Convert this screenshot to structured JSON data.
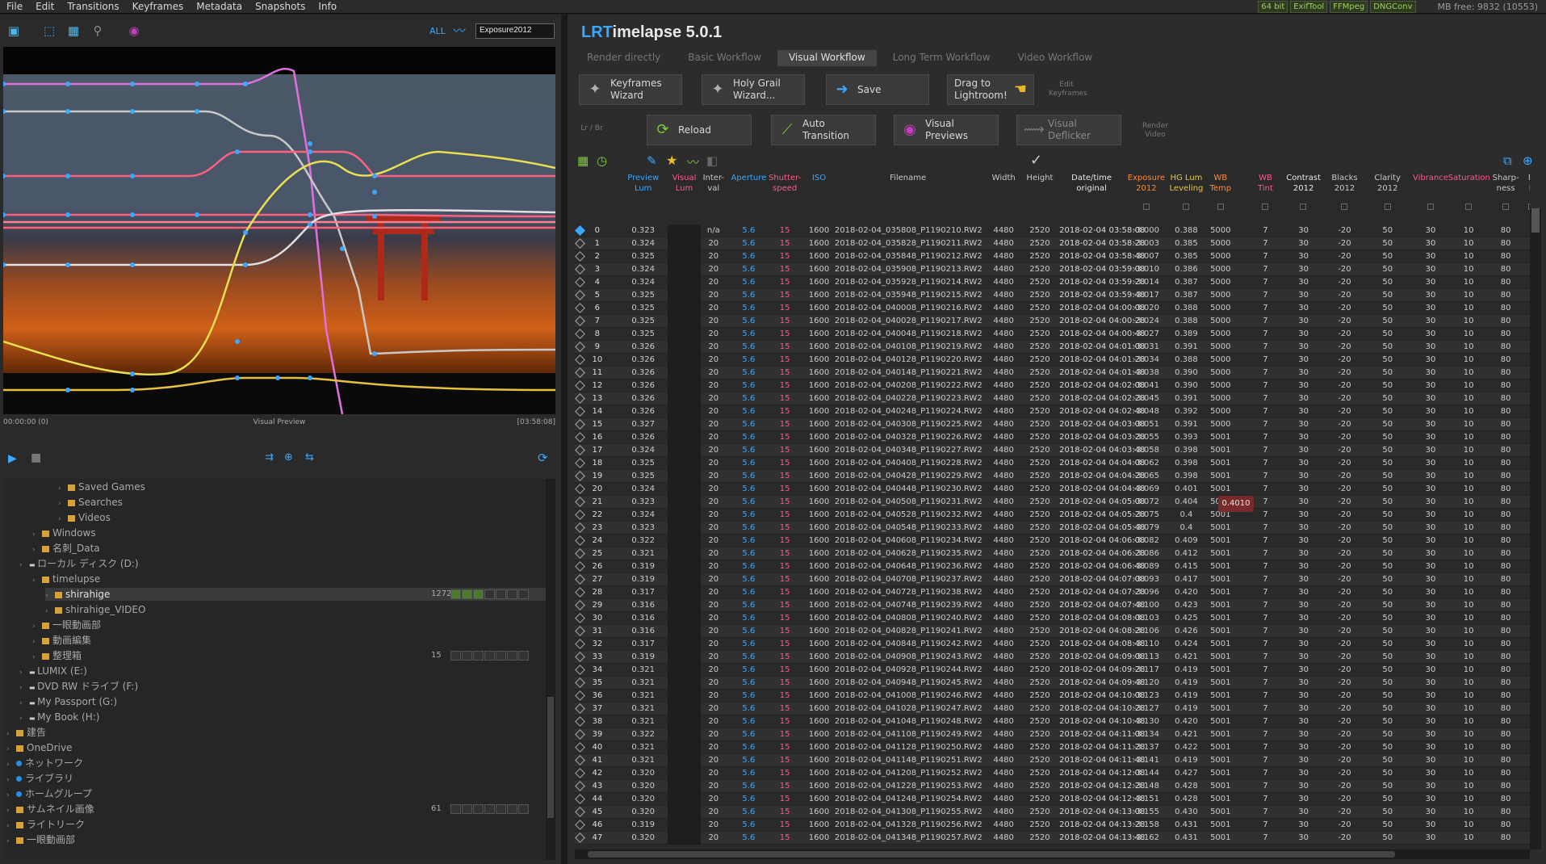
{
  "menu": [
    "File",
    "Edit",
    "Transitions",
    "Keyframes",
    "Metadata",
    "Snapshots",
    "Info"
  ],
  "badges": [
    "64 bit",
    "ExifTool",
    "FFMpeg",
    "DNGConv"
  ],
  "mbfree": "MB free: 9832 (10553)",
  "left_toolbar": {
    "all_label": "ALL",
    "curve_select": "Exposure2012"
  },
  "preview": {
    "time_start": "00:00:00 (0)",
    "label": "Visual Preview",
    "time_end": "[03:58:08]"
  },
  "tree": [
    {
      "label": "Saved Games",
      "indent": 4,
      "type": "folder"
    },
    {
      "label": "Searches",
      "indent": 4,
      "type": "folder"
    },
    {
      "label": "Videos",
      "indent": 4,
      "type": "folder"
    },
    {
      "label": "Windows",
      "indent": 2,
      "type": "folder"
    },
    {
      "label": "名刺_Data",
      "indent": 2,
      "type": "folder"
    },
    {
      "label": "ローカル ディスク (D:)",
      "indent": 1,
      "type": "drive"
    },
    {
      "label": "timelupse",
      "indent": 2,
      "type": "folder"
    },
    {
      "label": "shirahige",
      "indent": 3,
      "type": "folder",
      "selected": true,
      "count": "1272"
    },
    {
      "label": "shirahige_VIDEO",
      "indent": 3,
      "type": "folder"
    },
    {
      "label": "一眼動画部",
      "indent": 2,
      "type": "folder"
    },
    {
      "label": "動画編集",
      "indent": 2,
      "type": "folder"
    },
    {
      "label": "整理箱",
      "indent": 2,
      "type": "folder",
      "count": "15"
    },
    {
      "label": "LUMIX (E:)",
      "indent": 1,
      "type": "drive"
    },
    {
      "label": "DVD RW ドライブ (F:)",
      "indent": 1,
      "type": "drive"
    },
    {
      "label": "My Passport (G:)",
      "indent": 1,
      "type": "drive"
    },
    {
      "label": "My Book (H:)",
      "indent": 1,
      "type": "drive"
    },
    {
      "label": "建告",
      "indent": 0,
      "type": "folder"
    },
    {
      "label": "OneDrive",
      "indent": 0,
      "type": "folder"
    },
    {
      "label": "ネットワーク",
      "indent": 0,
      "type": "net"
    },
    {
      "label": "ライブラリ",
      "indent": 0,
      "type": "net"
    },
    {
      "label": "ホームグループ",
      "indent": 0,
      "type": "net"
    },
    {
      "label": "サムネイル画像",
      "indent": 0,
      "type": "folder",
      "count": "61"
    },
    {
      "label": "ライトリーク",
      "indent": 0,
      "type": "folder"
    },
    {
      "label": "一眼動画部",
      "indent": 0,
      "type": "folder"
    }
  ],
  "app": {
    "title_lr": "LRT",
    "title_rest": "imelapse 5.0.1"
  },
  "tabs": [
    "Render directly",
    "Basic Workflow",
    "Visual Workflow",
    "Long Term Workflow",
    "Video Workflow"
  ],
  "active_tab": 2,
  "buttons_row1": [
    "Keyframes\nWizard",
    "Holy Grail\nWizard...",
    "Save",
    "Drag to\nLightroom!"
  ],
  "edit_keyframes": "Edit\nKeyframes",
  "lr_br": "Lr / Br",
  "buttons_row2": [
    "Reload",
    "Auto\nTransition",
    "Visual\nPreviews",
    "Visual\nDeflicker"
  ],
  "render_video": "Render\nVideo",
  "columns": [
    "",
    "Preview\nLum",
    "Visual\nLum",
    "Inter-\nval",
    "Aperture",
    "Shutter-\nspeed",
    "ISO",
    "Filename",
    "Width",
    "Height",
    "Date/time\noriginal",
    "Exposure\n2012",
    "HG Lum\nLeveling",
    "WB\nTemp",
    "WB\nTint",
    "Contrast\n2012",
    "Blacks\n2012",
    "Clarity\n2012",
    "Vibrance",
    "Saturation",
    "Sharp-\nness",
    "N\nL"
  ],
  "rows": [
    [
      "0",
      "0.323",
      "n/a",
      "5.6",
      "15",
      "1600",
      "2018-02-04_035808_P1190210.RW2",
      "4480",
      "2520",
      "2018-02-04 03:58:08",
      "-3.000",
      "0.388",
      "5000"
    ],
    [
      "1",
      "0.324",
      "20",
      "5.6",
      "15",
      "1600",
      "2018-02-04_035828_P1190211.RW2",
      "4480",
      "2520",
      "2018-02-04 03:58:28",
      "-3.003",
      "0.385",
      "5000"
    ],
    [
      "2",
      "0.325",
      "20",
      "5.6",
      "15",
      "1600",
      "2018-02-04_035848_P1190212.RW2",
      "4480",
      "2520",
      "2018-02-04 03:58:48",
      "-3.007",
      "0.385",
      "5000"
    ],
    [
      "3",
      "0.324",
      "20",
      "5.6",
      "15",
      "1600",
      "2018-02-04_035908_P1190213.RW2",
      "4480",
      "2520",
      "2018-02-04 03:59:08",
      "-3.010",
      "0.386",
      "5000"
    ],
    [
      "4",
      "0.324",
      "20",
      "5.6",
      "15",
      "1600",
      "2018-02-04_035928_P1190214.RW2",
      "4480",
      "2520",
      "2018-02-04 03:59:28",
      "-3.014",
      "0.387",
      "5000"
    ],
    [
      "5",
      "0.325",
      "20",
      "5.6",
      "15",
      "1600",
      "2018-02-04_035948_P1190215.RW2",
      "4480",
      "2520",
      "2018-02-04 03:59:48",
      "-3.017",
      "0.387",
      "5000"
    ],
    [
      "6",
      "0.325",
      "20",
      "5.6",
      "15",
      "1600",
      "2018-02-04_040008_P1190216.RW2",
      "4480",
      "2520",
      "2018-02-04 04:00:08",
      "-3.020",
      "0.388",
      "5000"
    ],
    [
      "7",
      "0.325",
      "20",
      "5.6",
      "15",
      "1600",
      "2018-02-04_040028_P1190217.RW2",
      "4480",
      "2520",
      "2018-02-04 04:00:28",
      "-3.024",
      "0.388",
      "5000"
    ],
    [
      "8",
      "0.325",
      "20",
      "5.6",
      "15",
      "1600",
      "2018-02-04_040048_P1190218.RW2",
      "4480",
      "2520",
      "2018-02-04 04:00:48",
      "-3.027",
      "0.389",
      "5000"
    ],
    [
      "9",
      "0.326",
      "20",
      "5.6",
      "15",
      "1600",
      "2018-02-04_040108_P1190219.RW2",
      "4480",
      "2520",
      "2018-02-04 04:01:08",
      "-3.031",
      "0.391",
      "5000"
    ],
    [
      "10",
      "0.326",
      "20",
      "5.6",
      "15",
      "1600",
      "2018-02-04_040128_P1190220.RW2",
      "4480",
      "2520",
      "2018-02-04 04:01:28",
      "-3.034",
      "0.388",
      "5000"
    ],
    [
      "11",
      "0.326",
      "20",
      "5.6",
      "15",
      "1600",
      "2018-02-04_040148_P1190221.RW2",
      "4480",
      "2520",
      "2018-02-04 04:01:48",
      "-3.038",
      "0.390",
      "5000"
    ],
    [
      "12",
      "0.326",
      "20",
      "5.6",
      "15",
      "1600",
      "2018-02-04_040208_P1190222.RW2",
      "4480",
      "2520",
      "2018-02-04 04:02:08",
      "-3.041",
      "0.390",
      "5000"
    ],
    [
      "13",
      "0.326",
      "20",
      "5.6",
      "15",
      "1600",
      "2018-02-04_040228_P1190223.RW2",
      "4480",
      "2520",
      "2018-02-04 04:02:28",
      "-3.045",
      "0.391",
      "5000"
    ],
    [
      "14",
      "0.326",
      "20",
      "5.6",
      "15",
      "1600",
      "2018-02-04_040248_P1190224.RW2",
      "4480",
      "2520",
      "2018-02-04 04:02:48",
      "-3.048",
      "0.392",
      "5000"
    ],
    [
      "15",
      "0.327",
      "20",
      "5.6",
      "15",
      "1600",
      "2018-02-04_040308_P1190225.RW2",
      "4480",
      "2520",
      "2018-02-04 04:03:08",
      "-3.051",
      "0.391",
      "5000"
    ],
    [
      "16",
      "0.326",
      "20",
      "5.6",
      "15",
      "1600",
      "2018-02-04_040328_P1190226.RW2",
      "4480",
      "2520",
      "2018-02-04 04:03:28",
      "-3.055",
      "0.393",
      "5001"
    ],
    [
      "17",
      "0.324",
      "20",
      "5.6",
      "15",
      "1600",
      "2018-02-04_040348_P1190227.RW2",
      "4480",
      "2520",
      "2018-02-04 04:03:48",
      "-3.058",
      "0.398",
      "5001"
    ],
    [
      "18",
      "0.325",
      "20",
      "5.6",
      "15",
      "1600",
      "2018-02-04_040408_P1190228.RW2",
      "4480",
      "2520",
      "2018-02-04 04:04:08",
      "-3.062",
      "0.398",
      "5001"
    ],
    [
      "19",
      "0.325",
      "20",
      "5.6",
      "15",
      "1600",
      "2018-02-04_040428_P1190229.RW2",
      "4480",
      "2520",
      "2018-02-04 04:04:28",
      "-3.065",
      "0.398",
      "5001"
    ],
    [
      "20",
      "0.324",
      "20",
      "5.6",
      "15",
      "1600",
      "2018-02-04_040448_P1190230.RW2",
      "4480",
      "2520",
      "2018-02-04 04:04:48",
      "-3.069",
      "0.401",
      "5001"
    ],
    [
      "21",
      "0.323",
      "20",
      "5.6",
      "15",
      "1600",
      "2018-02-04_040508_P1190231.RW2",
      "4480",
      "2520",
      "2018-02-04 04:05:08",
      "-3.072",
      "0.404",
      "5001"
    ],
    [
      "22",
      "0.324",
      "20",
      "5.6",
      "15",
      "1600",
      "2018-02-04_040528_P1190232.RW2",
      "4480",
      "2520",
      "2018-02-04 04:05:28",
      "-3.075",
      "0.4",
      "5001"
    ],
    [
      "23",
      "0.323",
      "20",
      "5.6",
      "15",
      "1600",
      "2018-02-04_040548_P1190233.RW2",
      "4480",
      "2520",
      "2018-02-04 04:05:48",
      "-3.079",
      "0.4",
      "5001"
    ],
    [
      "24",
      "0.322",
      "20",
      "5.6",
      "15",
      "1600",
      "2018-02-04_040608_P1190234.RW2",
      "4480",
      "2520",
      "2018-02-04 04:06:08",
      "-3.082",
      "0.409",
      "5001"
    ],
    [
      "25",
      "0.321",
      "20",
      "5.6",
      "15",
      "1600",
      "2018-02-04_040628_P1190235.RW2",
      "4480",
      "2520",
      "2018-02-04 04:06:28",
      "-3.086",
      "0.412",
      "5001"
    ],
    [
      "26",
      "0.319",
      "20",
      "5.6",
      "15",
      "1600",
      "2018-02-04_040648_P1190236.RW2",
      "4480",
      "2520",
      "2018-02-04 04:06:48",
      "-3.089",
      "0.415",
      "5001"
    ],
    [
      "27",
      "0.319",
      "20",
      "5.6",
      "15",
      "1600",
      "2018-02-04_040708_P1190237.RW2",
      "4480",
      "2520",
      "2018-02-04 04:07:08",
      "-3.093",
      "0.417",
      "5001"
    ],
    [
      "28",
      "0.317",
      "20",
      "5.6",
      "15",
      "1600",
      "2018-02-04_040728_P1190238.RW2",
      "4480",
      "2520",
      "2018-02-04 04:07:28",
      "-3.096",
      "0.420",
      "5001"
    ],
    [
      "29",
      "0.316",
      "20",
      "5.6",
      "15",
      "1600",
      "2018-02-04_040748_P1190239.RW2",
      "4480",
      "2520",
      "2018-02-04 04:07:48",
      "-3.100",
      "0.423",
      "5001"
    ],
    [
      "30",
      "0.316",
      "20",
      "5.6",
      "15",
      "1600",
      "2018-02-04_040808_P1190240.RW2",
      "4480",
      "2520",
      "2018-02-04 04:08:08",
      "-3.103",
      "0.425",
      "5001"
    ],
    [
      "31",
      "0.316",
      "20",
      "5.6",
      "15",
      "1600",
      "2018-02-04_040828_P1190241.RW2",
      "4480",
      "2520",
      "2018-02-04 04:08:28",
      "-3.106",
      "0.426",
      "5001"
    ],
    [
      "32",
      "0.317",
      "20",
      "5.6",
      "15",
      "1600",
      "2018-02-04_040848_P1190242.RW2",
      "4480",
      "2520",
      "2018-02-04 04:08:48",
      "-3.110",
      "0.424",
      "5001"
    ],
    [
      "33",
      "0.319",
      "20",
      "5.6",
      "15",
      "1600",
      "2018-02-04_040908_P1190243.RW2",
      "4480",
      "2520",
      "2018-02-04 04:09:08",
      "-3.113",
      "0.421",
      "5001"
    ],
    [
      "34",
      "0.321",
      "20",
      "5.6",
      "15",
      "1600",
      "2018-02-04_040928_P1190244.RW2",
      "4480",
      "2520",
      "2018-02-04 04:09:28",
      "-3.117",
      "0.419",
      "5001"
    ],
    [
      "35",
      "0.321",
      "20",
      "5.6",
      "15",
      "1600",
      "2018-02-04_040948_P1190245.RW2",
      "4480",
      "2520",
      "2018-02-04 04:09:48",
      "-3.120",
      "0.419",
      "5001"
    ],
    [
      "36",
      "0.321",
      "20",
      "5.6",
      "15",
      "1600",
      "2018-02-04_041008_P1190246.RW2",
      "4480",
      "2520",
      "2018-02-04 04:10:08",
      "-3.123",
      "0.419",
      "5001"
    ],
    [
      "37",
      "0.321",
      "20",
      "5.6",
      "15",
      "1600",
      "2018-02-04_041028_P1190247.RW2",
      "4480",
      "2520",
      "2018-02-04 04:10:28",
      "-3.127",
      "0.419",
      "5001"
    ],
    [
      "38",
      "0.321",
      "20",
      "5.6",
      "15",
      "1600",
      "2018-02-04_041048_P1190248.RW2",
      "4480",
      "2520",
      "2018-02-04 04:10:48",
      "-3.130",
      "0.420",
      "5001"
    ],
    [
      "39",
      "0.322",
      "20",
      "5.6",
      "15",
      "1600",
      "2018-02-04_041108_P1190249.RW2",
      "4480",
      "2520",
      "2018-02-04 04:11:08",
      "-3.134",
      "0.421",
      "5001"
    ],
    [
      "40",
      "0.321",
      "20",
      "5.6",
      "15",
      "1600",
      "2018-02-04_041128_P1190250.RW2",
      "4480",
      "2520",
      "2018-02-04 04:11:28",
      "-3.137",
      "0.422",
      "5001"
    ],
    [
      "41",
      "0.321",
      "20",
      "5.6",
      "15",
      "1600",
      "2018-02-04_041148_P1190251.RW2",
      "4480",
      "2520",
      "2018-02-04 04:11:48",
      "-3.141",
      "0.419",
      "5001"
    ],
    [
      "42",
      "0.320",
      "20",
      "5.6",
      "15",
      "1600",
      "2018-02-04_041208_P1190252.RW2",
      "4480",
      "2520",
      "2018-02-04 04:12:08",
      "-3.144",
      "0.427",
      "5001"
    ],
    [
      "43",
      "0.320",
      "20",
      "5.6",
      "15",
      "1600",
      "2018-02-04_041228_P1190253.RW2",
      "4480",
      "2520",
      "2018-02-04 04:12:28",
      "-3.148",
      "0.428",
      "5001"
    ],
    [
      "44",
      "0.320",
      "20",
      "5.6",
      "15",
      "1600",
      "2018-02-04_041248_P1190254.RW2",
      "4480",
      "2520",
      "2018-02-04 04:12:48",
      "-3.151",
      "0.428",
      "5001"
    ],
    [
      "45",
      "0.320",
      "20",
      "5.6",
      "15",
      "1600",
      "2018-02-04_041308_P1190255.RW2",
      "4480",
      "2520",
      "2018-02-04 04:13:08",
      "-3.155",
      "0.430",
      "5001"
    ],
    [
      "46",
      "0.319",
      "20",
      "5.6",
      "15",
      "1600",
      "2018-02-04_041328_P1190256.RW2",
      "4480",
      "2520",
      "2018-02-04 04:13:28",
      "-3.158",
      "0.431",
      "5001"
    ],
    [
      "47",
      "0.320",
      "20",
      "5.6",
      "15",
      "1600",
      "2018-02-04_041348_P1190257.RW2",
      "4480",
      "2520",
      "2018-02-04 04:13:48",
      "-3.162",
      "0.431",
      "5001"
    ]
  ],
  "fixed_cols": {
    "tint": "7",
    "contrast": "30",
    "blacks": "-20",
    "clarity": "50",
    "vibrance": "30",
    "saturation": "10",
    "sharpness": "80"
  },
  "tooltip": "0.4010",
  "colors": {
    "accent": "#3aa8ff",
    "pink": "#ff5a8a",
    "yellow": "#e8c840",
    "orange": "#ff8a3a"
  }
}
